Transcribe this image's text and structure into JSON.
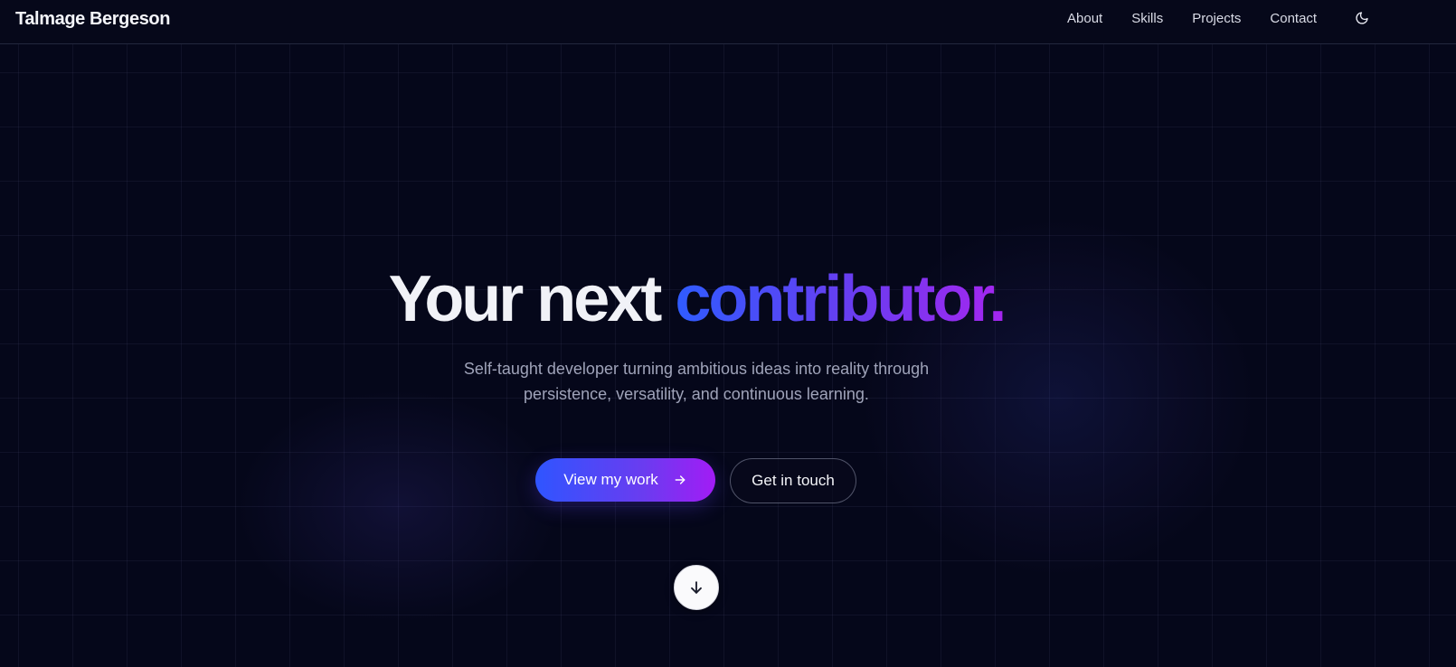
{
  "header": {
    "brand": "Talmage Bergeson",
    "nav": [
      {
        "label": "About"
      },
      {
        "label": "Skills"
      },
      {
        "label": "Projects"
      },
      {
        "label": "Contact"
      }
    ],
    "theme_toggle_icon": "moon-icon"
  },
  "hero": {
    "title_plain": "Your next ",
    "title_highlight": "contributor.",
    "subtitle": "Self-taught developer turning ambitious ideas into reality through persistence, versatility, and continuous learning.",
    "primary_cta": {
      "label": "View my work",
      "icon": "arrow-right-icon"
    },
    "secondary_cta": {
      "label": "Get in touch"
    },
    "scroll_icon": "arrow-down-icon"
  },
  "colors": {
    "background": "#05071a",
    "gradient_start": "#2f55ff",
    "gradient_end": "#a21cf5",
    "text_primary": "#f1f2f7",
    "text_muted": "#9fa3b9"
  }
}
